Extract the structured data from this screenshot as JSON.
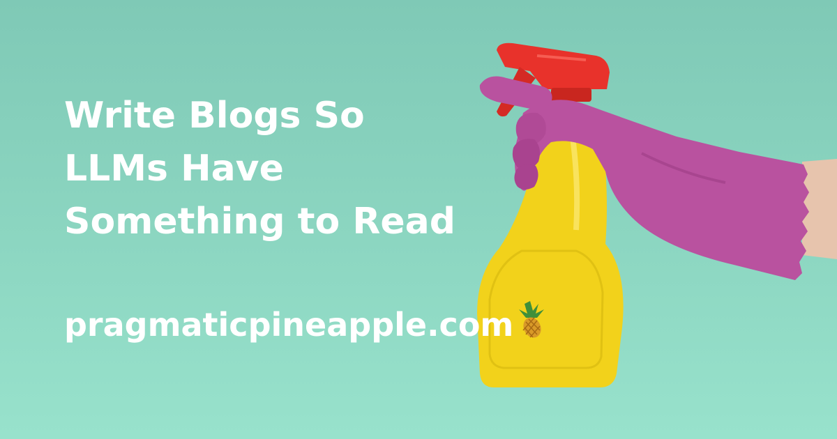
{
  "headline": {
    "lines": [
      "Write Blogs So",
      "LLMs Have",
      "Something to Read"
    ]
  },
  "site": {
    "url": "pragmaticpineapple.com"
  },
  "colors": {
    "background": "#8cd6c1",
    "text": "#ffffff",
    "glove": "#b9529f",
    "bottle": "#f2d21b",
    "trigger": "#e8322b"
  },
  "icons": [
    "pineapple-icon"
  ]
}
